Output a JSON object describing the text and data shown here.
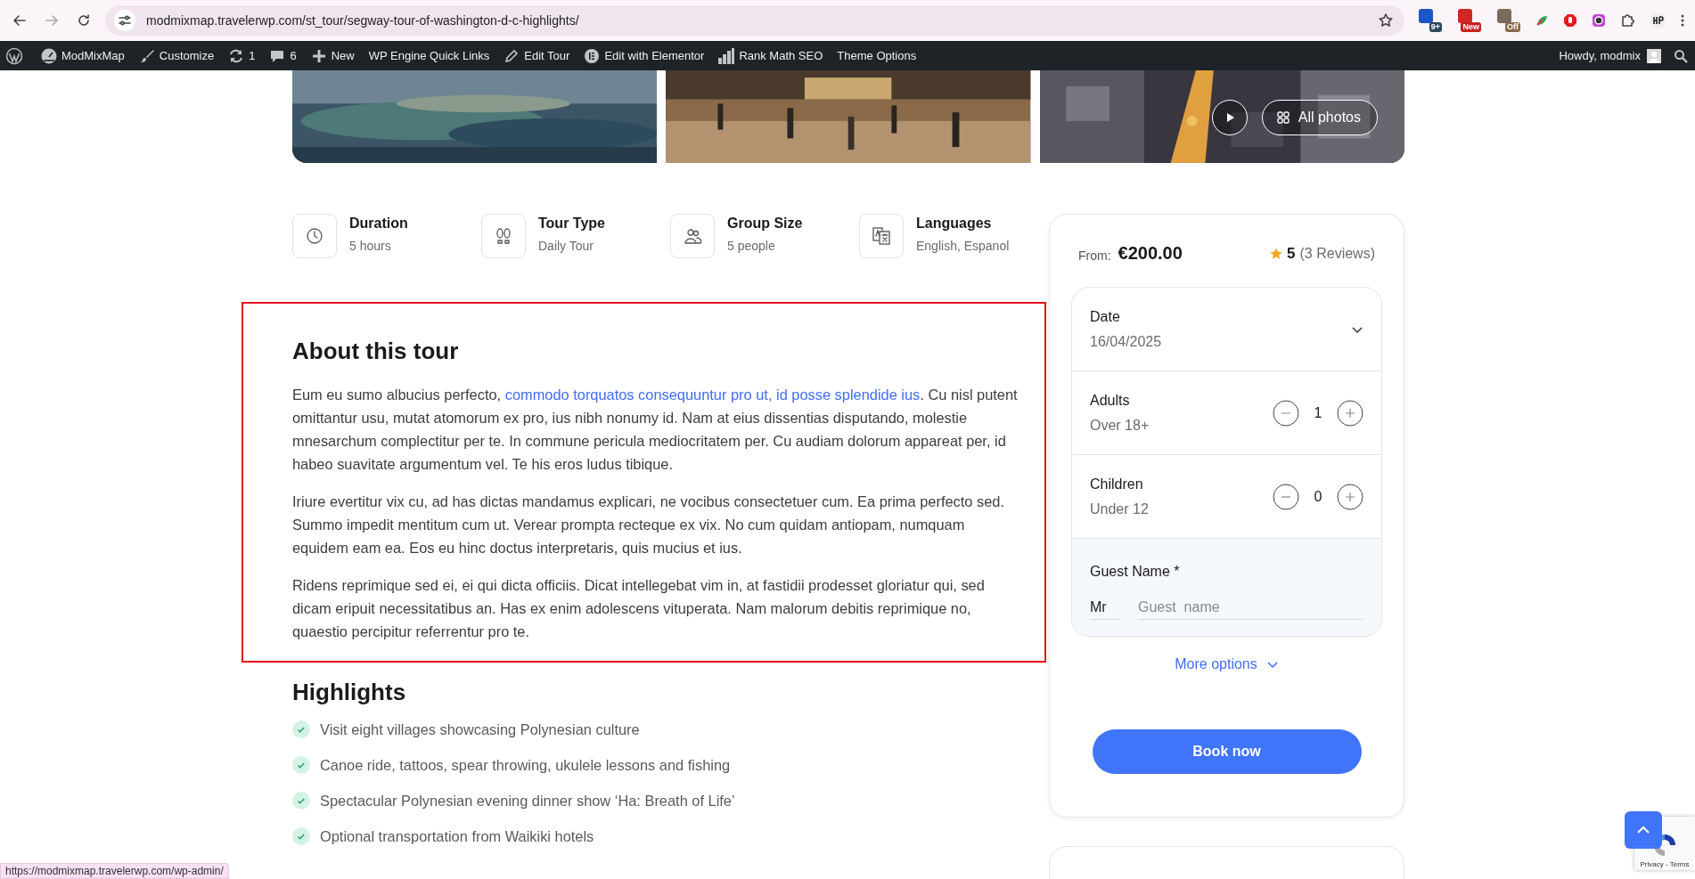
{
  "browser": {
    "url": "modmixmap.travelerwp.com/st_tour/segway-tour-of-washington-d-c-highlights/",
    "extension_badges": [
      "9+",
      "New",
      "Off"
    ],
    "status_url": "https://modmixmap.travelerwp.com/wp-admin/"
  },
  "admin_bar": {
    "items": [
      {
        "label": "ModMixMap"
      },
      {
        "label": "Customize"
      },
      {
        "label": "1"
      },
      {
        "label": "6"
      },
      {
        "label": "New"
      },
      {
        "label": "WP Engine Quick Links"
      },
      {
        "label": "Edit Tour"
      },
      {
        "label": "Edit with Elementor"
      },
      {
        "label": "Rank Math SEO"
      },
      {
        "label": "Theme Options"
      }
    ],
    "greeting": "Howdy, modmix"
  },
  "gallery": {
    "all_photos": "All photos"
  },
  "facts": [
    {
      "label": "Duration",
      "value": "5 hours"
    },
    {
      "label": "Tour Type",
      "value": "Daily Tour"
    },
    {
      "label": "Group Size",
      "value": "5 people"
    },
    {
      "label": "Languages",
      "value": "English, Espanol"
    }
  ],
  "about": {
    "title": "About this tour",
    "paragraphs": [
      [
        {
          "text": "Eum eu sumo albucius perfecto, "
        },
        {
          "text": "commodo torquatos consequuntur pro ut, id posse splendide ius",
          "link": true
        },
        {
          "text": ". Cu nisl putent omittantur usu, mutat atomorum ex pro, ius nibh nonumy id. Nam at eius dissentias disputando, molestie mnesarchum complectitur per te. In commune pericula mediocritatem per. Cu audiam dolorum appareat per, id habeo suavitate argumentum vel. Te his eros ludus tibique."
        }
      ],
      [
        {
          "text": "Iriure evertitur vix cu, ad has dictas mandamus explicari, ne vocibus consectetuer cum. Ea prima perfecto sed. Summo impedit mentitum cum ut. Verear prompta recteque ex vix. No cum quidam antiopam, numquam equidem eam ea. Eos eu hinc doctus interpretaris, quis mucius et ius."
        }
      ],
      [
        {
          "text": "Ridens reprimique sed ei, ei qui dicta officiis. Dicat intellegebat vim in, at fastidii prodesset gloriatur qui, sed dicam eripuit necessitatibus an. Has ex enim adolescens vituperata. Nam malorum debitis reprimique no, quaestio percipitur referrentur pro te."
        }
      ]
    ]
  },
  "highlights": {
    "title": "Highlights",
    "items": [
      "Visit eight villages showcasing Polynesian culture",
      "Canoe ride, tattoos, spear throwing, ukulele lessons and fishing",
      "Spectacular Polynesian evening dinner show ‘Ha: Breath of Life’",
      "Optional transportation from Waikiki hotels"
    ]
  },
  "booking": {
    "from_label": "From:",
    "price": "€200.00",
    "rating": "5",
    "reviews": "(3 Reviews)",
    "date": {
      "label": "Date",
      "value": "16/04/2025"
    },
    "guests": [
      {
        "label": "Adults",
        "note": "Over 18+",
        "count": "1"
      },
      {
        "label": "Children",
        "note": "Under 12",
        "count": "0"
      }
    ],
    "guest_name": {
      "label": "Guest Name *",
      "title_value": "Mr",
      "placeholder": "Guest  name"
    },
    "more_options": "More options",
    "book_button": "Book now"
  },
  "recaptcha": {
    "links": "Privacy - Terms"
  }
}
